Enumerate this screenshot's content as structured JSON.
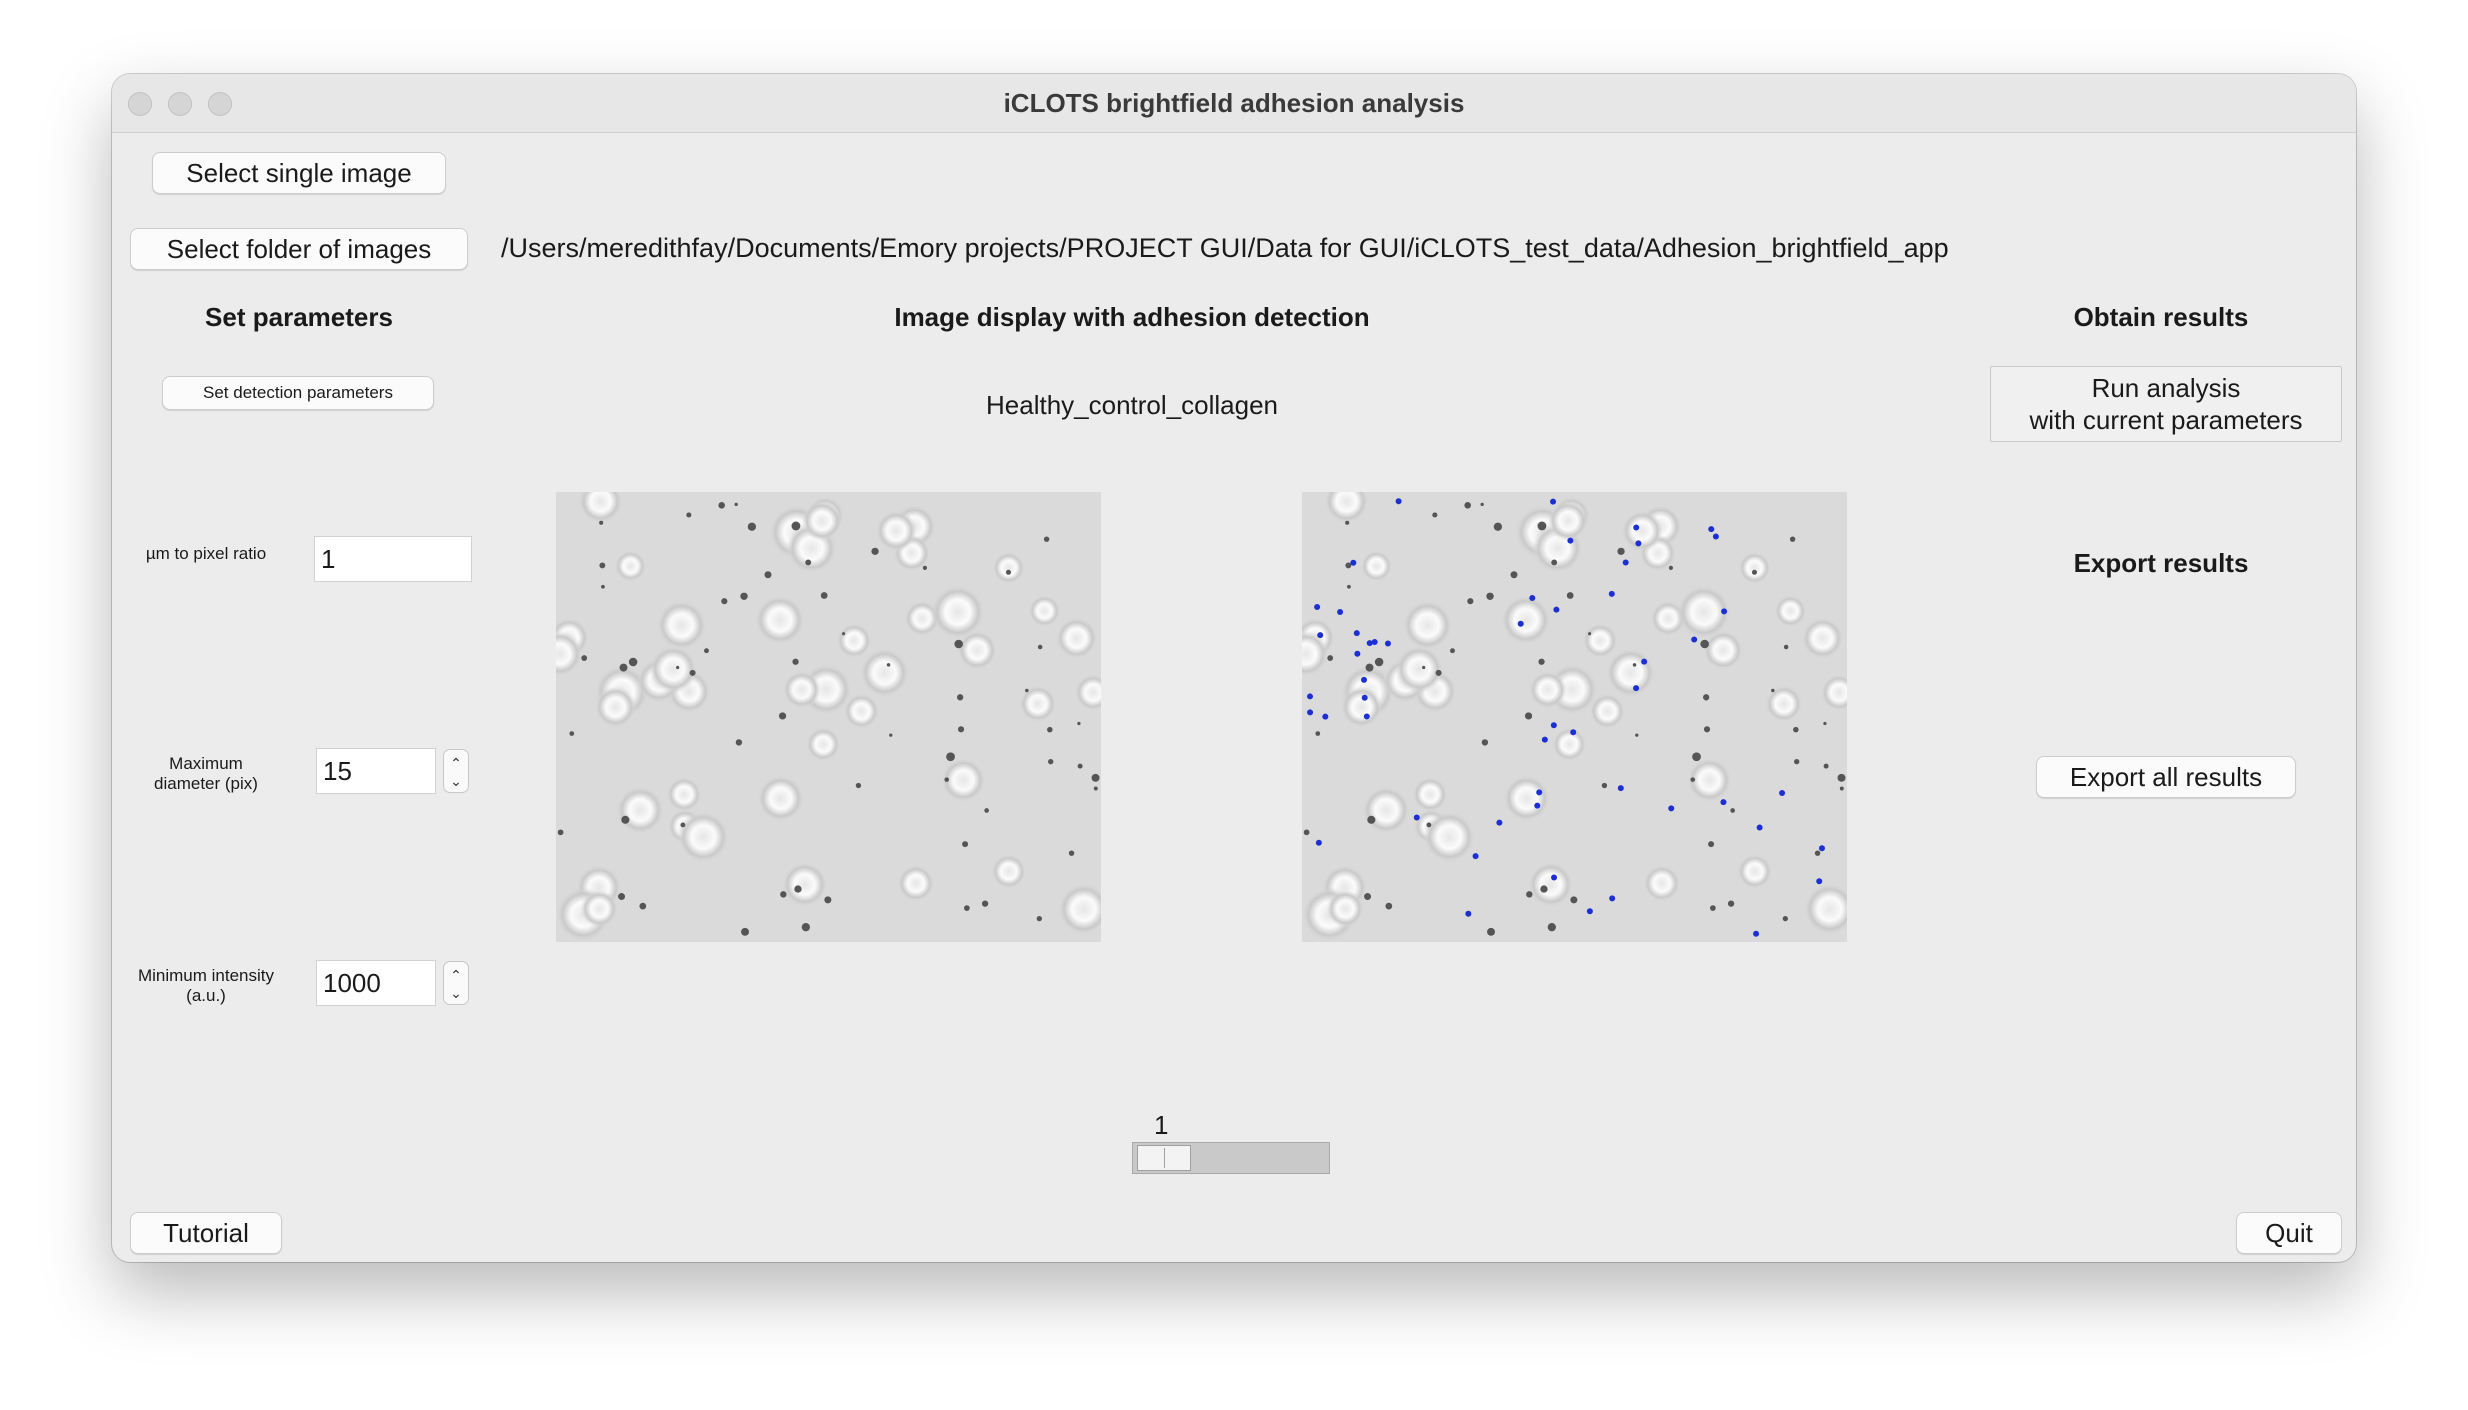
{
  "window": {
    "title": "iCLOTS brightfield adhesion analysis"
  },
  "top": {
    "select_single_label": "Select single image",
    "select_folder_label": "Select folder of images",
    "folder_path": "/Users/meredithfay/Documents/Emory projects/PROJECT GUI/Data for GUI/iCLOTS_test_data/Adhesion_brightfield_app"
  },
  "left": {
    "heading": "Set parameters",
    "detection_button_label": "Set detection parameters",
    "params": [
      {
        "label": "µm to pixel ratio",
        "value": "1"
      },
      {
        "label": "Maximum diameter (pix)",
        "value": "15"
      },
      {
        "label": "Minimum intensity (a.u.)",
        "value": "1000"
      }
    ]
  },
  "center": {
    "heading": "Image display with adhesion detection",
    "image_name": "Healthy_control_collagen",
    "original_image": "brightfield-micrograph",
    "detected_image": "brightfield-micrograph-with-blue-detection-markers",
    "slider_value": "1",
    "marker_color": "#1c2fd4"
  },
  "right": {
    "obtain_heading": "Obtain results",
    "run_line1": "Run analysis",
    "run_line2": "with current parameters",
    "export_heading": "Export results",
    "export_all_label": "Export all results"
  },
  "bottom": {
    "tutorial_label": "Tutorial",
    "quit_label": "Quit"
  }
}
